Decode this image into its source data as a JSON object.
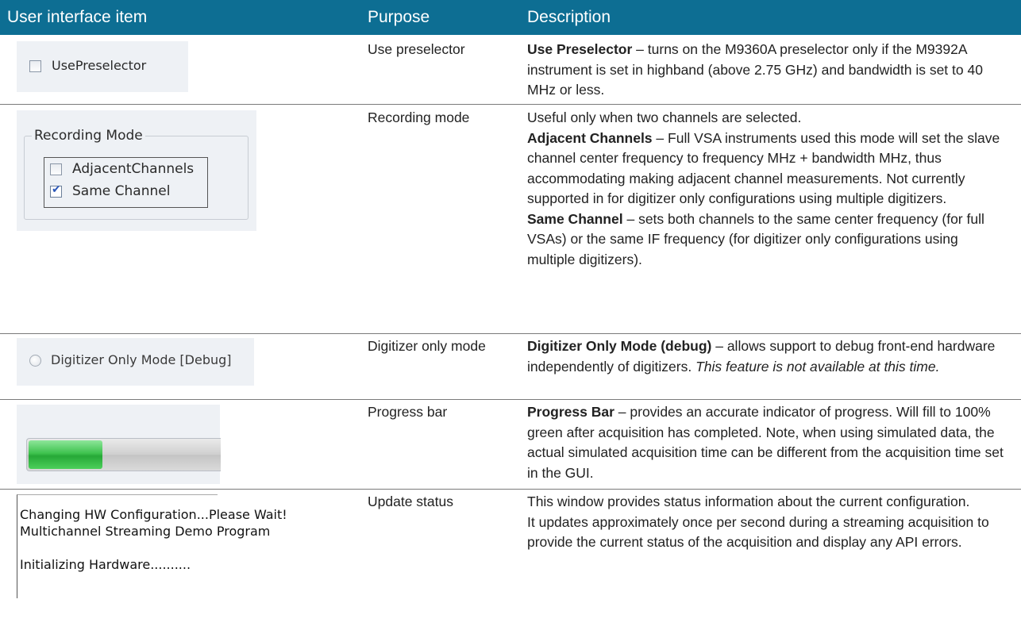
{
  "header": {
    "col1": "User interface item",
    "col2": "Purpose",
    "col3": "Description"
  },
  "rows": [
    {
      "purpose": "Use preselector",
      "ui_label": "UsePreselector",
      "term": "Use Preselector",
      "desc": "turns on the M9360A preselector only if the M9392A instrument is set in highband (above 2.75 GHz) and bandwidth is set to 40 MHz or less."
    },
    {
      "purpose": "Recording mode",
      "group_title": "Recording Mode",
      "option1": "AdjacentChannels",
      "option2": "Same Channel",
      "intro": "Useful only when two channels are selected.",
      "term1": "Adjacent Channels",
      "desc1": "Full VSA instruments used this mode will set the slave channel center frequency to frequency MHz + bandwidth MHz, thus accommodating making adjacent channel measurements. Not currently supported in for digitizer only configurations using multiple digitizers.",
      "term2": "Same Channel",
      "desc2": "sets both channels to the same center frequency (for full VSAs) or the same IF frequency (for digitizer only configurations using multiple digitizers)."
    },
    {
      "purpose": "Digitizer only mode",
      "ui_label": "Digitizer Only Mode [Debug]",
      "term": "Digitizer Only Mode (debug)",
      "desc": "allows support to debug front-end hardware independently of digitizers.",
      "note": "This feature is not available at this time."
    },
    {
      "purpose": "Progress bar",
      "progress_fraction": 0.38,
      "term": "Progress Bar",
      "desc": "provides an accurate indicator of progress. Will fill to 100% green after acquisition has completed. Note, when using simulated data, the actual simulated acquisition time can be different from the acquisition time set in the GUI."
    },
    {
      "purpose": "Update status",
      "status_line1": "Changing HW Configuration...Please Wait!",
      "status_line2": "Multichannel Streaming Demo Program",
      "status_line3": "Initializing Hardware..........",
      "desc_p1": "This window provides status information about the current configuration.",
      "desc_p2": "It updates approximately once per second during a streaming acquisition to provide the current status of the acquisition and display any API errors."
    }
  ],
  "separator": " – "
}
